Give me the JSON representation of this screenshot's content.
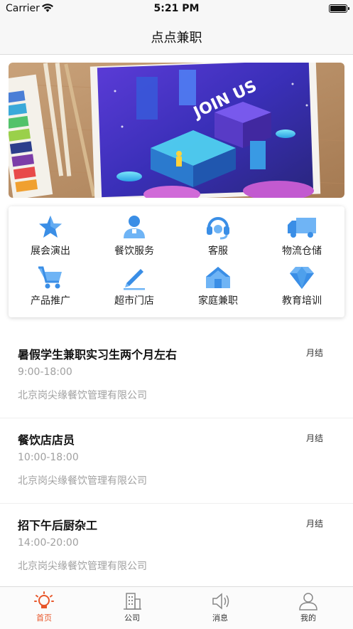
{
  "status_bar": {
    "carrier": "Carrier",
    "time": "5:21 PM"
  },
  "nav": {
    "title": "点点兼职"
  },
  "banner": {
    "text": "JOIN US"
  },
  "categories": [
    {
      "label": "展会演出",
      "icon": "star-icon"
    },
    {
      "label": "餐饮服务",
      "icon": "waiter-icon"
    },
    {
      "label": "客服",
      "icon": "headset-icon"
    },
    {
      "label": "物流仓储",
      "icon": "truck-icon"
    },
    {
      "label": "产品推广",
      "icon": "cart-icon"
    },
    {
      "label": "超市门店",
      "icon": "pen-icon"
    },
    {
      "label": "家庭兼职",
      "icon": "house-icon"
    },
    {
      "label": "教育培训",
      "icon": "diamond-icon"
    }
  ],
  "jobs": [
    {
      "title": "暑假学生兼职实习生两个月左右",
      "pay": "月结",
      "time": "9:00-18:00",
      "company": "北京岗尖缘餐饮管理有限公司"
    },
    {
      "title": "餐饮店店员",
      "pay": "月结",
      "time": "10:00-18:00",
      "company": "北京岗尖缘餐饮管理有限公司"
    },
    {
      "title": "招下午后厨杂工",
      "pay": "月结",
      "time": "14:00-20:00",
      "company": "北京岗尖缘餐饮管理有限公司"
    }
  ],
  "tabs": [
    {
      "label": "首页",
      "icon": "home-bulb-icon",
      "active": true
    },
    {
      "label": "公司",
      "icon": "building-icon",
      "active": false
    },
    {
      "label": "消息",
      "icon": "speaker-icon",
      "active": false
    },
    {
      "label": "我的",
      "icon": "user-icon",
      "active": false
    }
  ],
  "colors": {
    "accent": "#e8562a",
    "icon_blue": "#3a8ee6",
    "muted_text": "#a0a0a0"
  }
}
